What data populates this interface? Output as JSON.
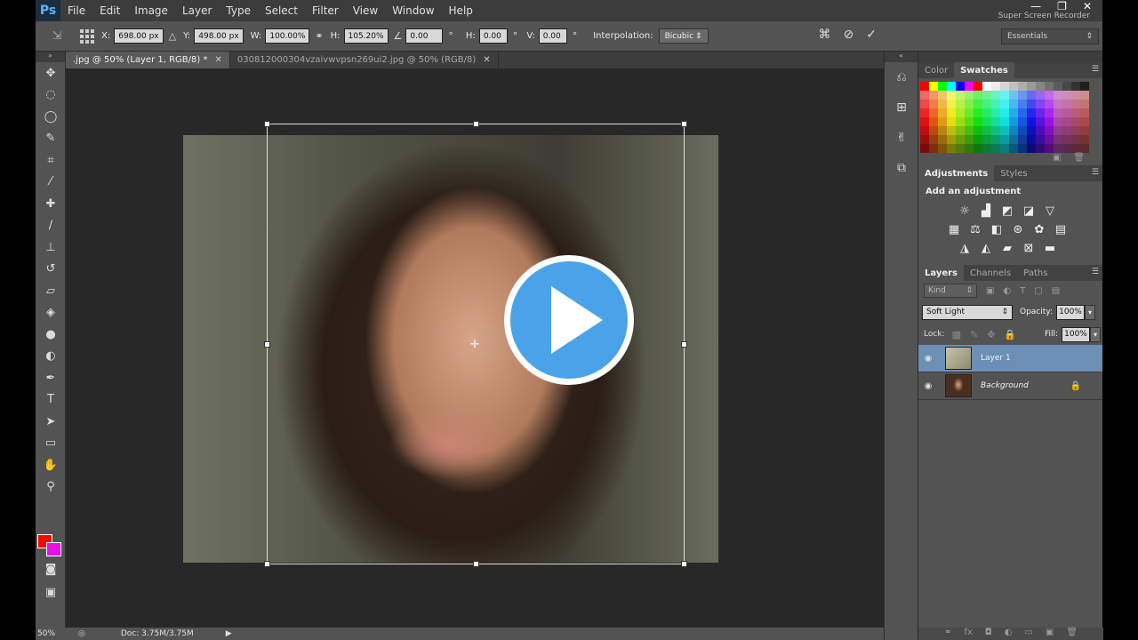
{
  "app": {
    "logo": "Ps"
  },
  "menu": [
    "File",
    "Edit",
    "Image",
    "Layer",
    "Type",
    "Select",
    "Filter",
    "View",
    "Window",
    "Help"
  ],
  "window_controls": {
    "minimize": "—",
    "restore": "❐",
    "close": "✕"
  },
  "watermark": "Super Screen Recorder",
  "options": {
    "x_label": "X:",
    "x_value": "698.00 px",
    "y_label": "Y:",
    "y_value": "498.00 px",
    "w_label": "W:",
    "w_value": "100.00%",
    "h_label": "H:",
    "h_value": "105.20%",
    "angle_value": "0.00",
    "deg": "°",
    "hskew_label": "H:",
    "hskew_value": "0.00",
    "vskew_label": "V:",
    "vskew_value": "0.00",
    "interp_label": "Interpolation:",
    "interp_value": "Bicubic",
    "workspace": "Essentials"
  },
  "tabs": [
    {
      "label": ".jpg @ 50% (Layer 1, RGB/8) *",
      "active": true
    },
    {
      "label": "030812000304vzaivwvpsn269ui2.jpg @ 50% (RGB/8)",
      "active": false
    }
  ],
  "status": {
    "zoom": "50%",
    "doc": "Doc: 3.75M/3.75M"
  },
  "color_panel": {
    "tabs": [
      "Color",
      "Swatches"
    ],
    "active": "Swatches"
  },
  "adjustments_panel": {
    "tabs": [
      "Adjustments",
      "Styles"
    ],
    "title": "Add an adjustment"
  },
  "layers_panel": {
    "tabs": [
      "Layers",
      "Channels",
      "Paths"
    ],
    "kind": "Kind",
    "blend_mode": "Soft Light",
    "opacity_label": "Opacity:",
    "opacity": "100%",
    "lock_label": "Lock:",
    "fill_label": "Fill:",
    "fill": "100%",
    "layers": [
      {
        "name": "Layer 1",
        "selected": true,
        "locked": false
      },
      {
        "name": "Background",
        "selected": false,
        "locked": true
      }
    ]
  }
}
